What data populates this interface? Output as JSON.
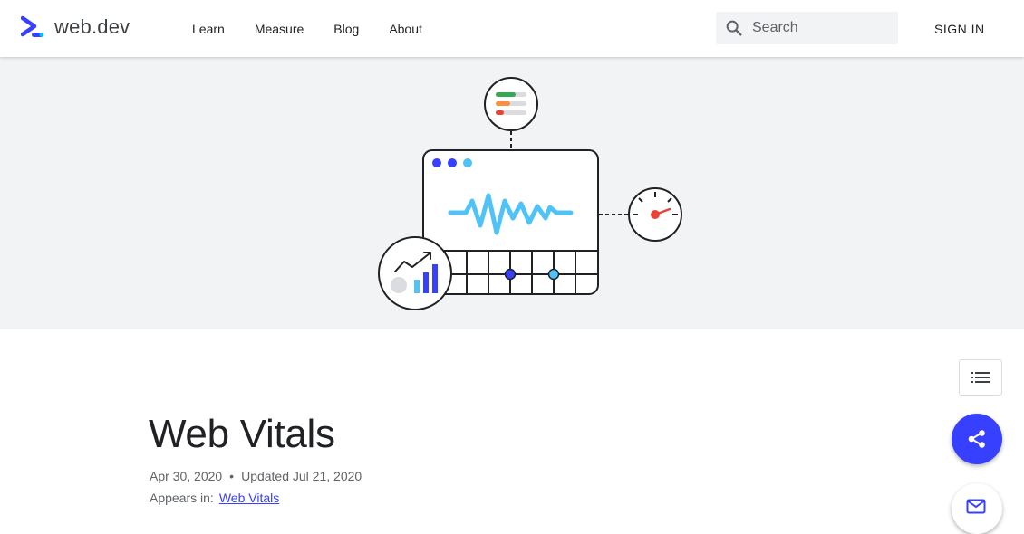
{
  "header": {
    "logo_text": "web.dev",
    "nav": [
      "Learn",
      "Measure",
      "Blog",
      "About"
    ],
    "search_placeholder": "Search",
    "signin_label": "SIGN IN"
  },
  "article": {
    "title": "Web Vitals",
    "published": "Apr 30, 2020",
    "separator": "•",
    "updated": "Updated Jul 21, 2020",
    "appears_label": "Appears in:",
    "appears_link": "Web Vitals"
  },
  "colors": {
    "brand": "#3740ff",
    "hero_bg": "#f1f3f4",
    "wave": "#4fc3f7",
    "good": "#34a853",
    "needs_improvement": "#fa903e",
    "poor": "#ea4335"
  },
  "icons": {
    "logo": "web-dev-logo-icon",
    "search": "search-icon",
    "toc": "list-icon",
    "share": "share-icon",
    "subscribe": "mail-add-icon"
  }
}
